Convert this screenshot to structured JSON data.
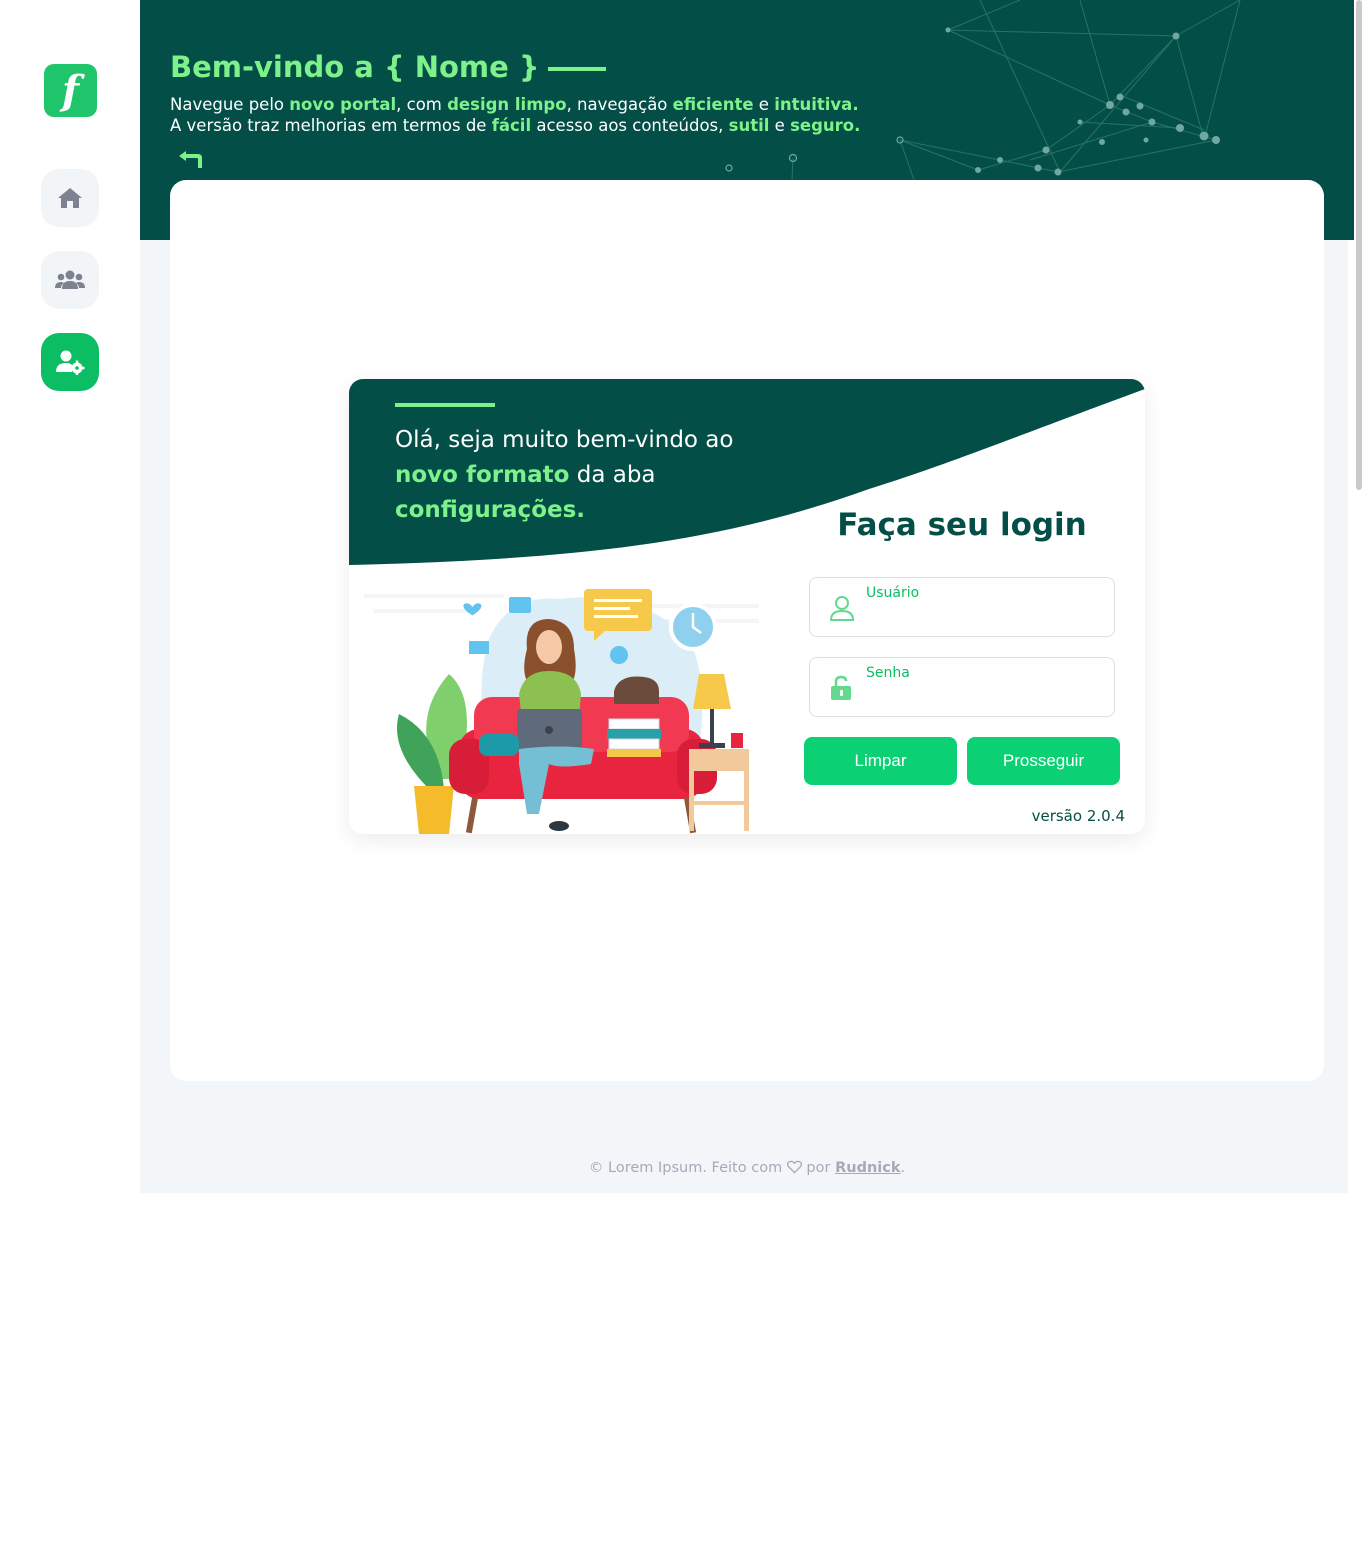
{
  "sidebar": {
    "logo_text": "f",
    "items": [
      {
        "name": "home",
        "icon": "home-icon",
        "active": false
      },
      {
        "name": "users",
        "icon": "users-icon",
        "active": false
      },
      {
        "name": "user-settings",
        "icon": "user-gear-icon",
        "active": true
      }
    ]
  },
  "hero": {
    "title": "Bem-vindo a { Nome }",
    "line1": [
      {
        "text": "Navegue pelo ",
        "highlight": false
      },
      {
        "text": "novo portal",
        "highlight": true
      },
      {
        "text": ", com ",
        "highlight": false
      },
      {
        "text": "design limpo",
        "highlight": true
      },
      {
        "text": ", navegação ",
        "highlight": false
      },
      {
        "text": "eficiente",
        "highlight": true
      },
      {
        "text": " e ",
        "highlight": false
      },
      {
        "text": "intuitiva.",
        "highlight": true
      }
    ],
    "line2": [
      {
        "text": "A versão traz melhorias em termos de ",
        "highlight": false
      },
      {
        "text": "fácil",
        "highlight": true
      },
      {
        "text": " acesso aos conteúdos, ",
        "highlight": false
      },
      {
        "text": "sutil",
        "highlight": true
      },
      {
        "text": " e ",
        "highlight": false
      },
      {
        "text": "seguro.",
        "highlight": true
      }
    ],
    "back_icon": "back-arrow-icon"
  },
  "login": {
    "welcome_prefix": "Olá, seja muito bem-vindo ao",
    "welcome_highlight1": "novo formato",
    "welcome_middle": " da aba",
    "welcome_highlight2": "configurações.",
    "title": "Faça seu login",
    "user_label": "Usuário",
    "user_value": "",
    "pass_label": "Senha",
    "pass_value": "",
    "clear_label": "Limpar",
    "next_label": "Prosseguir",
    "version": "versão 2.0.4"
  },
  "footer": {
    "prefix": "© Lorem Ipsum. Feito com",
    "by": "por",
    "author": "Rudnick",
    "suffix": "."
  },
  "colors": {
    "dark_green": "#034f47",
    "accent_green": "#7ef28a",
    "button_green": "#0bd074",
    "active_nav": "#0bbe63",
    "background": "#f3f6f9"
  }
}
